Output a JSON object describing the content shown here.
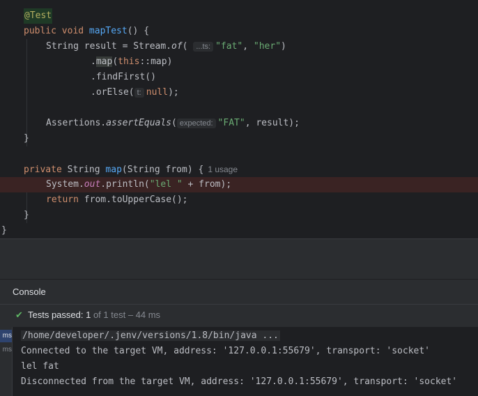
{
  "editor": {
    "ann": "@Test",
    "l2": {
      "kw": "public void ",
      "name": "mapTest",
      "rest": "() {"
    },
    "l3": {
      "a": "String result = Stream.",
      "b": "of",
      "c": "(",
      "hint": "...ts:",
      "s1": "\"fat\"",
      "comma": ", ",
      "s2": "\"her\"",
      "end": ")"
    },
    "l4": {
      "dot": ".",
      "fn": "map",
      "p": "(",
      "kw": "this",
      "rest": "::map)"
    },
    "l5": ".findFirst()",
    "l6": {
      "a": ".orElse(",
      "hint": "t:",
      "kw": "null",
      "end": ");"
    },
    "l8": {
      "a": "Assertions.",
      "fn": "assertEquals",
      "p": "(",
      "hint": "expected:",
      "s": "\"FAT\"",
      "rest": ", result);"
    },
    "l9": "}",
    "l11": {
      "kw": "private ",
      "t": "String ",
      "name": "map",
      "rest": "(String from) {",
      "usage": "1 usage"
    },
    "l12": {
      "a": "System.",
      "out": "out",
      "b": ".println(",
      "s": "\"lel \"",
      "rest": " + from);"
    },
    "l13": {
      "kw": "return ",
      "rest": "from.toUpperCase();"
    },
    "l14": "}",
    "l15": "}"
  },
  "tool_window": {
    "tab_console": "Console",
    "status": {
      "check_icon": "✔",
      "passed": "Tests passed: ",
      "count": "1",
      "of": " of 1 test – 44 ms"
    },
    "gutter": [
      "ms",
      "ms"
    ],
    "lines": [
      "/home/developer/.jenv/versions/1.8/bin/java ...",
      "Connected to the target VM, address: '127.0.0.1:55679', transport: 'socket'",
      "lel fat",
      "Disconnected from the target VM, address: '127.0.0.1:55679', transport: 'socket'"
    ]
  },
  "colors": {
    "accent": "#3574f0",
    "keyword": "#cf8e6d",
    "function": "#56a8f5",
    "string": "#6aab73",
    "success": "#5fb865"
  }
}
